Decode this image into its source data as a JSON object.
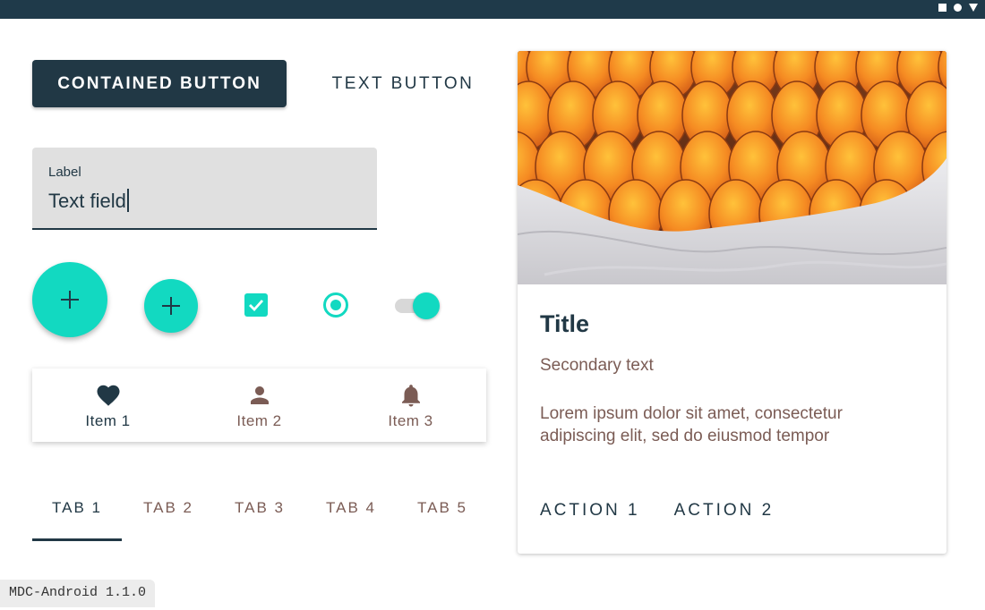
{
  "status_bar": {
    "icons": [
      "square-icon",
      "circle-icon",
      "triangle-icon"
    ]
  },
  "buttons": {
    "contained_label": "CONTAINED BUTTON",
    "text_label": "TEXT BUTTON"
  },
  "text_field": {
    "label": "Label",
    "value": "Text field"
  },
  "controls": {
    "fab_large_icon": "plus-icon",
    "fab_small_icon": "plus-icon",
    "checkbox_checked": true,
    "radio_selected": true,
    "switch_on": true
  },
  "bottom_nav": {
    "items": [
      {
        "label": "Item 1",
        "icon": "heart-icon",
        "active": true
      },
      {
        "label": "Item 2",
        "icon": "person-icon",
        "active": false
      },
      {
        "label": "Item 3",
        "icon": "bell-icon",
        "active": false
      }
    ]
  },
  "tabs": {
    "items": [
      {
        "label": "TAB 1",
        "active": true
      },
      {
        "label": "TAB 2",
        "active": false
      },
      {
        "label": "TAB 3",
        "active": false
      },
      {
        "label": "TAB 4",
        "active": false
      },
      {
        "label": "TAB 5",
        "active": false
      }
    ]
  },
  "card": {
    "title": "Title",
    "secondary": "Secondary text",
    "body": "Lorem ipsum dolor sit amet, consectetur adipiscing elit, sed do eiusmod tempor",
    "actions": [
      "ACTION 1",
      "ACTION 2"
    ]
  },
  "version_badge": "MDC-Android 1.1.0",
  "colors": {
    "primary": "#213845",
    "secondary": "#12d9c1",
    "on_surface_variant": "#7b5c55",
    "text_field_bg": "#e0e0e0"
  }
}
